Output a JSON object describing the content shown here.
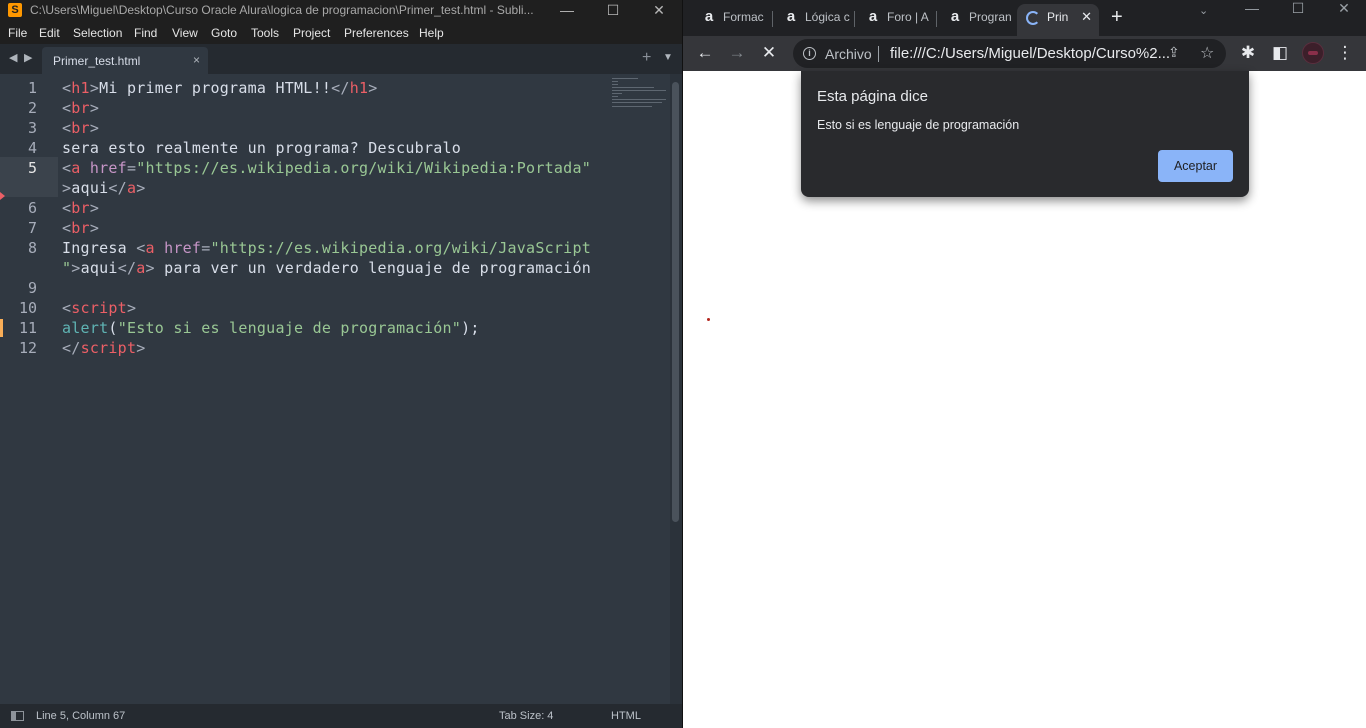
{
  "sublime": {
    "app_icon": "S",
    "title": "C:\\Users\\Miguel\\Desktop\\Curso Oracle Alura\\logica de programacion\\Primer_test.html - Subli...",
    "window_controls": {
      "minimize": "—",
      "maximize": "☐",
      "close": "✕"
    },
    "menu": [
      "File",
      "Edit",
      "Selection",
      "Find",
      "View",
      "Goto",
      "Tools",
      "Project",
      "Preferences",
      "Help"
    ],
    "tab": {
      "label": "Primer_test.html",
      "close": "×"
    },
    "tabbar_icons": {
      "back": "◀",
      "forward": "▶",
      "new_tab": "+",
      "dropdown": "▼"
    },
    "gutter": [
      "1",
      "2",
      "3",
      "4",
      "5",
      "",
      "6",
      "7",
      "8",
      "",
      "9",
      "10",
      "11",
      "12"
    ],
    "code": {
      "l1": {
        "lt1": "<",
        "tag1": "h1",
        "gt1": ">",
        "text": "Mi primer programa HTML!!",
        "lt2": "</",
        "tag2": "h1",
        "gt2": ">"
      },
      "l2": {
        "lt": "<",
        "tag": "br",
        "gt": ">"
      },
      "l3": {
        "lt": "<",
        "tag": "br",
        "gt": ">"
      },
      "l4": {
        "text": "sera esto realmente un programa? Descubralo"
      },
      "l5": {
        "lt": "<",
        "tag": "a",
        "attr": " href",
        "eq": "=",
        "str": "\"https://es.wikipedia.org/wiki/Wikipedia:Portada\""
      },
      "l5b": {
        "gt": ">",
        "text": "aqui",
        "lt": "</",
        "tag": "a",
        "gt2": ">"
      },
      "l6": {
        "lt": "<",
        "tag": "br",
        "gt": ">"
      },
      "l7": {
        "lt": "<",
        "tag": "br",
        "gt": ">"
      },
      "l8": {
        "text": "Ingresa ",
        "lt": "<",
        "tag": "a",
        "attr": " href",
        "eq": "=",
        "str": "\"https://es.wikipedia.org/wiki/JavaScript"
      },
      "l8b": {
        "str": "\"",
        "gt": ">",
        "text": "aqui",
        "lt": "</",
        "tag": "a",
        "gt2": ">",
        "rest": " para ver un verdadero lenguaje de programación"
      },
      "l10": {
        "lt": "<",
        "tag": "script",
        "gt": ">"
      },
      "l11": {
        "fn": "alert",
        "open": "(",
        "str": "\"Esto si es lenguaje de programación\"",
        "close": ");"
      },
      "l12": {
        "lt": "</",
        "tag": "script",
        "gt": ">"
      }
    },
    "status": {
      "position": "Line 5, Column 67",
      "tab_size": "Tab Size: 4",
      "syntax": "HTML"
    }
  },
  "chrome": {
    "tabs": [
      {
        "label": "Formac",
        "favicon": "a"
      },
      {
        "label": "Lógica c",
        "favicon": "a"
      },
      {
        "label": "Foro | A",
        "favicon": "a"
      },
      {
        "label": "Progran",
        "favicon": "a"
      },
      {
        "label": "Prin",
        "favicon": "",
        "close": "✕",
        "active": true
      }
    ],
    "new_tab": "+",
    "tab_search": "⌄",
    "window_controls": {
      "minimize": "—",
      "maximize": "☐",
      "close": "✕"
    },
    "toolbar": {
      "back": "←",
      "forward": "→",
      "stop": "✕",
      "extensions": "✱",
      "side_panel": "◧",
      "menu": "⋮"
    },
    "omnibox": {
      "info": "i",
      "scheme": "Archivo",
      "url": "file:///C:/Users/Miguel/Desktop/Curso%2...",
      "share": "⇪",
      "star": "☆"
    },
    "dialog": {
      "title": "Esta página dice",
      "message": "Esto si es lenguaje de programación",
      "button": "Aceptar"
    }
  },
  "colors": {
    "sublime_bg": "#303841",
    "sublime_chrome": "#1f1f1f",
    "tag": "#ec5f66",
    "attr": "#c695c6",
    "string": "#99c794",
    "function": "#5fb4b4",
    "chrome_dark": "#202124",
    "chrome_toolbar": "#35363a",
    "dialog_bg": "#292a2d",
    "accent_blue": "#8ab4f8"
  }
}
